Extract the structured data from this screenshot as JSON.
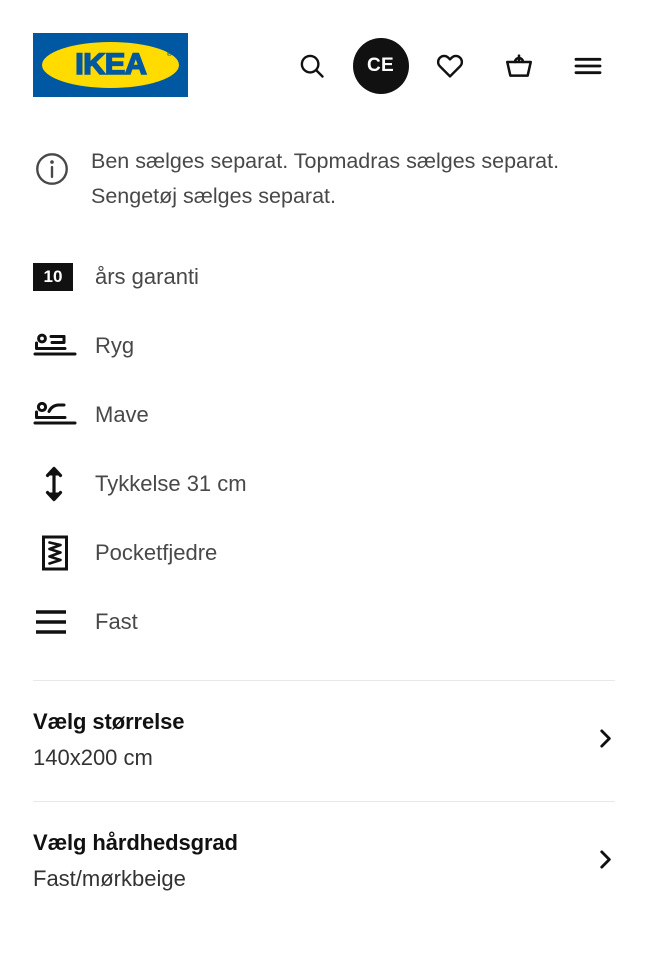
{
  "brand": {
    "logo_text": "IKEA",
    "logo_trademark": "®",
    "logo_bg_color": "#0058A3",
    "logo_ellipse_color": "#FFDB00"
  },
  "header": {
    "icons": [
      {
        "name": "search-icon",
        "label": "Søg"
      },
      {
        "name": "account-avatar",
        "label": "CE"
      },
      {
        "name": "heart-icon",
        "label": "Favoritter"
      },
      {
        "name": "shopping-bag-icon",
        "label": "Indkøbskurv"
      },
      {
        "name": "hamburger-menu-icon",
        "label": "Menu"
      }
    ],
    "avatar_initials": "CE"
  },
  "notice": {
    "icon": "info-icon",
    "text": "Ben sælges separat. Topmadras sælges separat. Sengetøj sælges separat."
  },
  "features": [
    {
      "icon": "warranty-badge-icon",
      "badge": "10",
      "label": "års garanti"
    },
    {
      "icon": "sleep-position-back-icon",
      "label": "Ryg"
    },
    {
      "icon": "sleep-position-stomach-icon",
      "label": "Mave"
    },
    {
      "icon": "thickness-arrow-icon",
      "label": "Tykkelse 31 cm"
    },
    {
      "icon": "pocket-spring-icon",
      "label": "Pocketfjedre"
    },
    {
      "icon": "firmness-lines-icon",
      "label": "Fast"
    }
  ],
  "selectors": [
    {
      "name": "size",
      "title": "Vælg størrelse",
      "value": "140x200 cm",
      "chevron": "chevron-right-icon"
    },
    {
      "name": "firmness",
      "title": "Vælg hårdhedsgrad",
      "value": "Fast/mørkbeige",
      "chevron": "chevron-right-icon"
    }
  ],
  "colors": {
    "text_primary": "#111111",
    "text_secondary": "#484848",
    "divider": "#E8E8E8",
    "accent_blue": "#0058A3",
    "accent_yellow": "#FFDB00"
  }
}
